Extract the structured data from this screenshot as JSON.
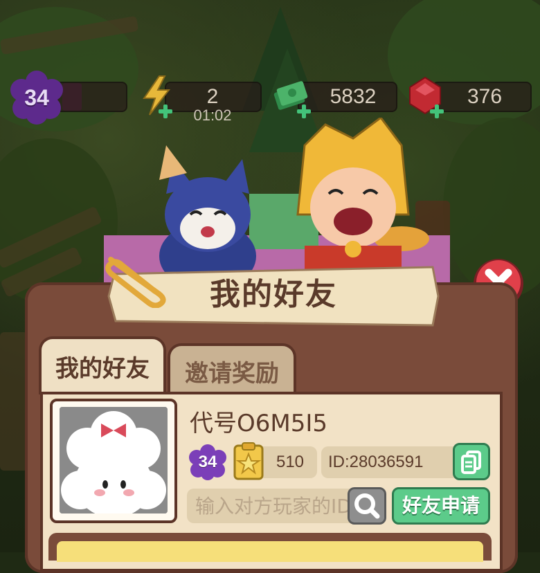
{
  "hud": {
    "level": "34",
    "energy": "2",
    "energy_timer": "01:02",
    "cash": "5832",
    "gems": "376"
  },
  "dialog": {
    "title": "我的好友",
    "tabs": [
      {
        "label": "我的好友",
        "active": true
      },
      {
        "label": "邀请奖励",
        "active": false
      }
    ],
    "profile": {
      "name": "代号O6M5I5",
      "level": "34",
      "stars": "510",
      "id": "ID:28036591"
    },
    "search": {
      "placeholder": "输入对方玩家的ID"
    },
    "apply_label": "好友申请"
  },
  "colors": {
    "panel": "#7a4b3a",
    "content_bg": "#f2e2c6",
    "green_button": "#5ccb8a",
    "close_red": "#e0404a",
    "level_purple": "#6a2fa0"
  }
}
